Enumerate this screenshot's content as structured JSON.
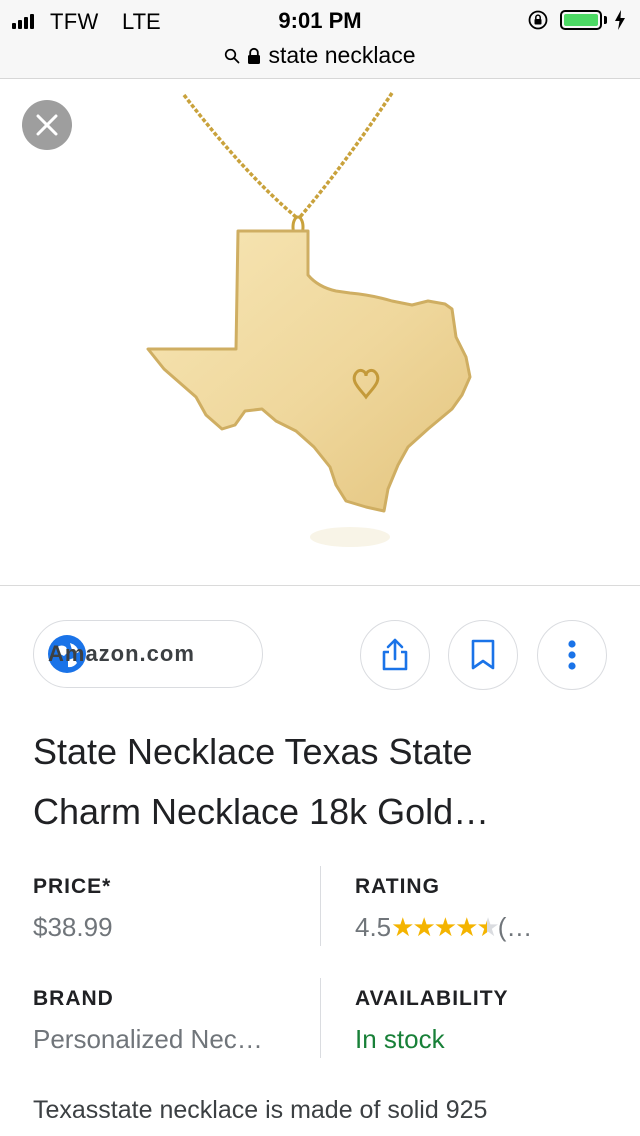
{
  "status_bar": {
    "carrier": "TFW",
    "network": "LTE",
    "time": "9:01 PM"
  },
  "url_bar": {
    "query": "state necklace"
  },
  "image": {
    "subject_icon": "texas-state-necklace-image"
  },
  "source": {
    "site": "Amazon.com"
  },
  "actions": [
    "share",
    "bookmark",
    "more"
  ],
  "product": {
    "title_line1": "State Necklace Texas State",
    "title_line2": "Charm Necklace 18k Gold…"
  },
  "details": {
    "price_label": "PRICE*",
    "price_value": "$38.99",
    "rating_label": "RATING",
    "rating_value": "4.5",
    "rating_stars": 4.5,
    "rating_count": "(…",
    "brand_label": "BRAND",
    "brand_value": "Personalized Nec…",
    "availability_label": "AVAILABILITY",
    "availability_value": "In stock"
  },
  "description": "Texasstate necklace is made of solid 925",
  "colors": {
    "battery": "#4cd964",
    "link_blue": "#1a73e8",
    "star": "#f4b400",
    "in_stock_green": "#188038"
  }
}
